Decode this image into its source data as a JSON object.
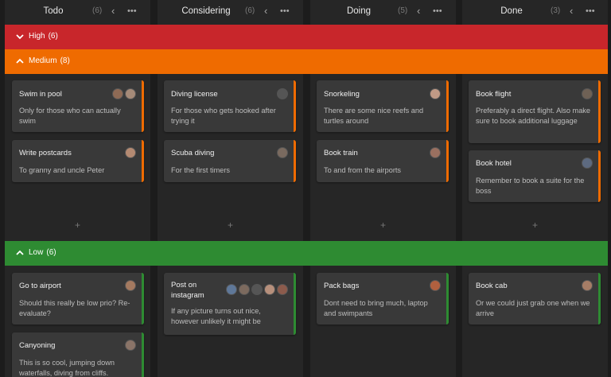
{
  "columns": [
    {
      "title": "Todo",
      "count": "(6)"
    },
    {
      "title": "Considering",
      "count": "(6)"
    },
    {
      "title": "Doing",
      "count": "(5)"
    },
    {
      "title": "Done",
      "count": "(3)"
    }
  ],
  "icons": {
    "collapse": "chevron-left-icon",
    "more": "more-horizontal-icon",
    "add": "plus-icon"
  },
  "colors": {
    "high": "#c8262b",
    "medium": "#ef6b00",
    "low": "#2e8b32"
  },
  "lanes": {
    "high": {
      "name": "High",
      "count": "(6)"
    },
    "medium": {
      "name": "Medium",
      "count": "(8)"
    },
    "low": {
      "name": "Low",
      "count": "(6)"
    }
  },
  "add_label": "+",
  "cards": {
    "medium": {
      "todo": [
        {
          "title": "Swim in pool",
          "desc": "Only for those who can actually swim"
        },
        {
          "title": "Write postcards",
          "desc": "To granny and uncle Peter"
        }
      ],
      "considering": [
        {
          "title": "Diving license",
          "desc": "For those who gets hooked after trying it"
        },
        {
          "title": "Scuba diving",
          "desc": "For the first timers"
        }
      ],
      "doing": [
        {
          "title": "Snorkeling",
          "desc": "There are some nice reefs and turtles around"
        },
        {
          "title": "Book train",
          "desc": "To and from the airports"
        }
      ],
      "done": [
        {
          "title": "Book flight",
          "desc": "Preferably a direct flight. Also make sure to book additional luggage"
        },
        {
          "title": "Book hotel",
          "desc": "Remember to book a suite for the boss"
        }
      ]
    },
    "low": {
      "todo": [
        {
          "title": "Go to airport",
          "desc": "Should this really be low prio? Re-evaluate?"
        },
        {
          "title": "Canyoning",
          "desc": "This is so cool, jumping down waterfalls, diving from cliffs."
        }
      ],
      "considering": [
        {
          "title": "Post on instagram",
          "desc": "If any picture turns out nice, however unlikely it might be"
        }
      ],
      "doing": [
        {
          "title": "Pack bags",
          "desc": "Dont need to bring much, laptop and swimpants"
        }
      ],
      "done": [
        {
          "title": "Book cab",
          "desc": "Or we could just grab one when we arrive"
        }
      ]
    }
  }
}
